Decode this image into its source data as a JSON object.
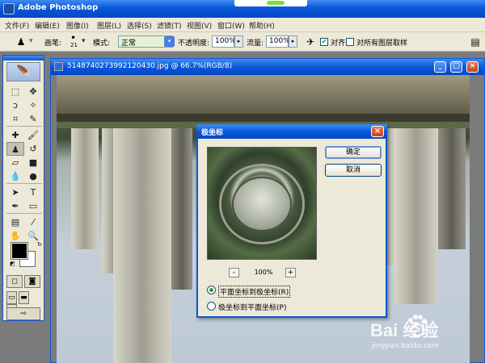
{
  "app": {
    "title": "Adobe Photoshop"
  },
  "menu": [
    "文件(F)",
    "编辑(E)",
    "图像(I)",
    "图层(L)",
    "选择(S)",
    "滤镜(T)",
    "视图(V)",
    "窗口(W)",
    "帮助(H)"
  ],
  "options": {
    "brush_label": "画笔:",
    "brush_size": "21",
    "mode_label": "模式:",
    "mode_value": "正常",
    "opacity_label": "不透明度:",
    "opacity_value": "100%",
    "flow_label": "流量:",
    "flow_value": "100%",
    "align_label": "对齐",
    "align_checked": true,
    "all_layers_label": "对所有图层取样",
    "all_layers_checked": false
  },
  "document": {
    "title": "5148740273992120430.jpg @ 66.7%(RGB/8)"
  },
  "dialog": {
    "title": "极坐标",
    "ok_label": "确定",
    "cancel_label": "取消",
    "zoom_minus": "-",
    "zoom_value": "100%",
    "zoom_plus": "+",
    "option1_label": "平面坐标到极坐标(R)",
    "option1_selected": true,
    "option2_label": "极坐标到平面坐标(P)",
    "option2_selected": false
  },
  "watermark": {
    "logo": "Bai  经验",
    "url": "jingyan.baidu.com"
  },
  "colors": {
    "xp_blue": "#0a58d8",
    "chrome": "#ece9d8",
    "mode_field": "#e3f3cf"
  }
}
